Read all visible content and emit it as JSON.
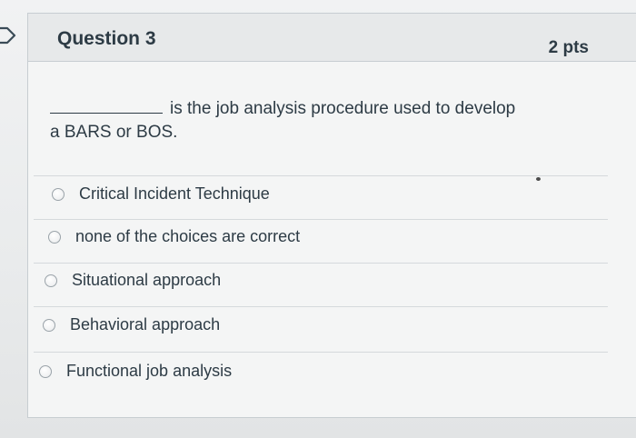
{
  "question": {
    "title": "Question 3",
    "points": "2 pts",
    "stem_text": "is the job analysis procedure used to develop",
    "stem_text_line2": "a BARS or BOS."
  },
  "answers": [
    {
      "label": "Critical Incident Technique",
      "selected": false
    },
    {
      "label": "none of the choices are correct",
      "selected": false
    },
    {
      "label": "Situational approach",
      "selected": false
    },
    {
      "label": "Behavioral approach",
      "selected": false
    },
    {
      "label": "Functional job analysis",
      "selected": false
    }
  ],
  "colors": {
    "text": "#2d3b45",
    "border": "#c7cdd1",
    "header_bg": "#e7e9ea"
  }
}
